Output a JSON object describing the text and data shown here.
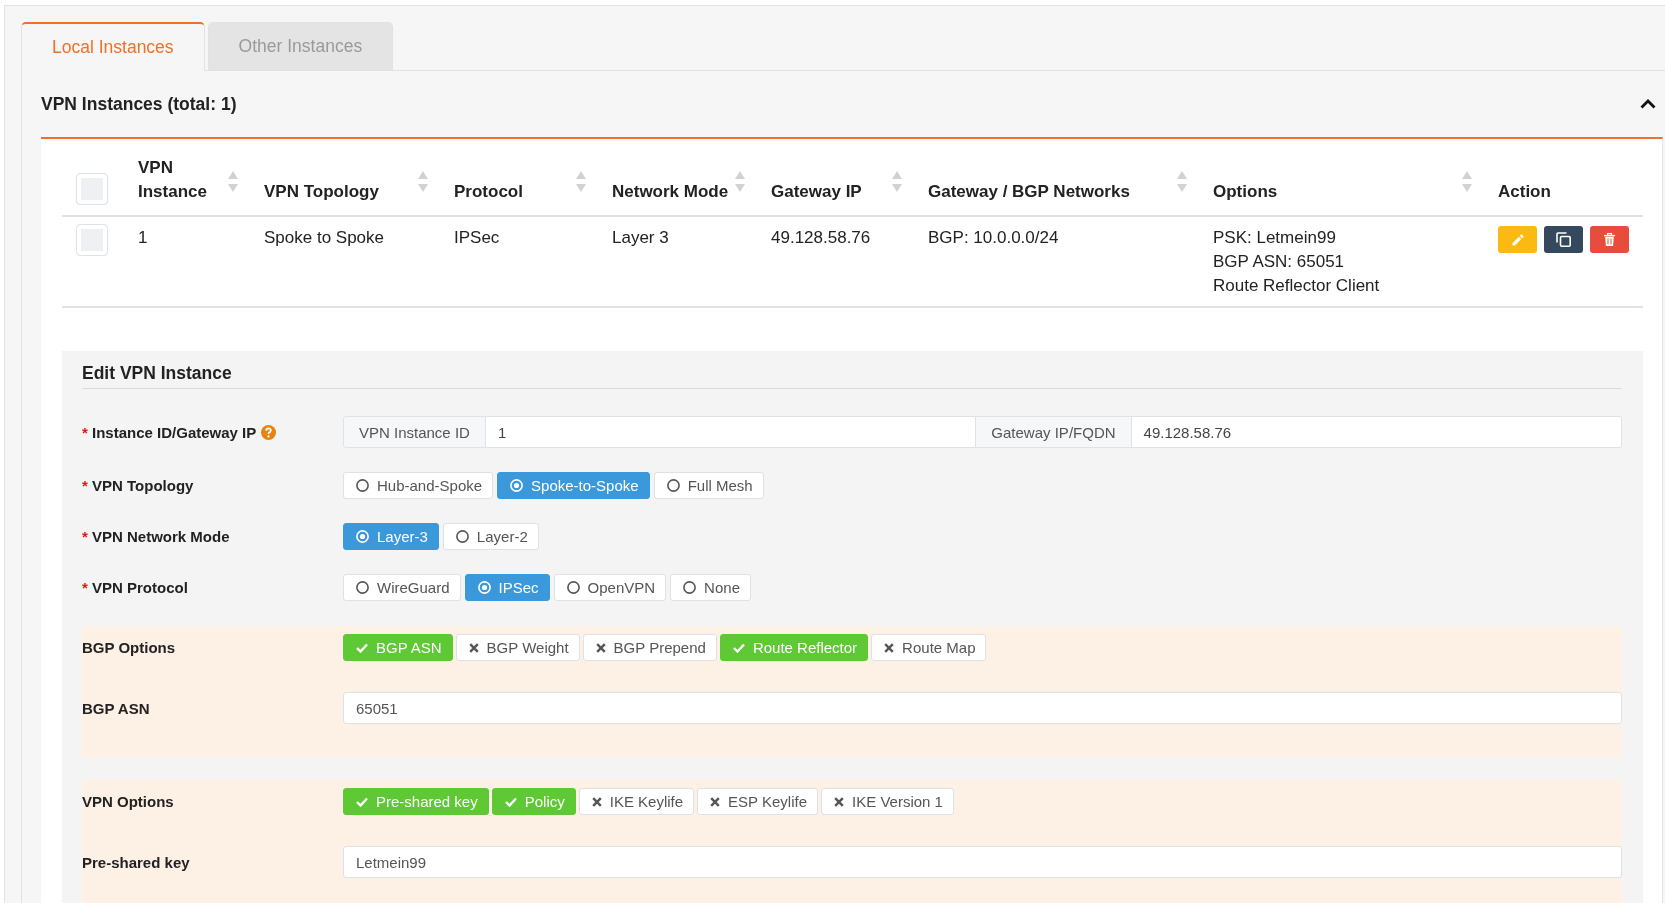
{
  "tabs": [
    {
      "label": "Local Instances",
      "selected": true
    },
    {
      "label": "Other Instances",
      "selected": false
    }
  ],
  "instances_panel": {
    "title": "VPN Instances (total: 1)",
    "expanded": true,
    "table": {
      "select_all": {
        "checked": false
      },
      "columns": [
        {
          "label": "VPN Instance",
          "sortable": true
        },
        {
          "label": "VPN Topology",
          "sortable": true
        },
        {
          "label": "Protocol",
          "sortable": true
        },
        {
          "label": "Network Mode",
          "sortable": true
        },
        {
          "label": "Gateway IP",
          "sortable": true
        },
        {
          "label": "Gateway / BGP Networks",
          "sortable": true
        },
        {
          "label": "Options",
          "sortable": true
        },
        {
          "label": "Action",
          "sortable": false
        }
      ],
      "rows": [
        {
          "selected": false,
          "cells": [
            "1",
            "Spoke to Spoke",
            "IPSec",
            "Layer 3",
            "49.128.58.76",
            "BGP: 10.0.0.0/24"
          ],
          "options": [
            "PSK: Letmein99",
            "BGP ASN: 65051",
            "Route Reflector Client"
          ],
          "actions": [
            {
              "kind": "edit"
            },
            {
              "kind": "copy"
            },
            {
              "kind": "delete"
            }
          ]
        }
      ]
    }
  },
  "edit_form": {
    "title": "Edit VPN Instance",
    "fields": [
      {
        "kind": "input_group",
        "label": "Instance ID/Gateway IP",
        "required_mark": "*",
        "help": true,
        "parts": [
          {
            "addon": "VPN Instance ID",
            "value": "1"
          },
          {
            "addon": "Gateway IP/FQDN",
            "value": "49.128.58.76"
          }
        ]
      },
      {
        "kind": "radio",
        "label": "VPN Topology",
        "required_mark": "*",
        "options": [
          {
            "label": "Hub-and-Spoke",
            "selected": false
          },
          {
            "label": "Spoke-to-Spoke",
            "selected": true
          },
          {
            "label": "Full Mesh",
            "selected": false
          }
        ]
      },
      {
        "kind": "radio",
        "label": "VPN Network Mode",
        "required_mark": "*",
        "options": [
          {
            "label": "Layer-3",
            "selected": true
          },
          {
            "label": "Layer-2",
            "selected": false
          }
        ]
      },
      {
        "kind": "radio",
        "label": "VPN Protocol",
        "required_mark": "*",
        "options": [
          {
            "label": "WireGuard",
            "selected": false
          },
          {
            "label": "IPSec",
            "selected": true
          },
          {
            "label": "OpenVPN",
            "selected": false
          },
          {
            "label": "None",
            "selected": false
          }
        ]
      }
    ],
    "option_groups": [
      {
        "fields": [
          {
            "kind": "toggles",
            "label": "BGP Options",
            "options": [
              {
                "label": "BGP ASN",
                "on": true
              },
              {
                "label": "BGP Weight",
                "on": false
              },
              {
                "label": "BGP Prepend",
                "on": false
              },
              {
                "label": "Route Reflector",
                "on": true
              },
              {
                "label": "Route Map",
                "on": false
              }
            ]
          },
          {
            "kind": "text",
            "label": "BGP ASN",
            "value": "65051"
          }
        ]
      },
      {
        "fields": [
          {
            "kind": "toggles",
            "label": "VPN Options",
            "options": [
              {
                "label": "Pre-shared key",
                "on": true
              },
              {
                "label": "Policy",
                "on": true
              },
              {
                "label": "IKE Keylife",
                "on": false
              },
              {
                "label": "ESP Keylife",
                "on": false
              },
              {
                "label": "IKE Version 1",
                "on": false
              }
            ]
          },
          {
            "kind": "text",
            "label": "Pre-shared key",
            "value": "Letmein99"
          }
        ]
      }
    ]
  }
}
